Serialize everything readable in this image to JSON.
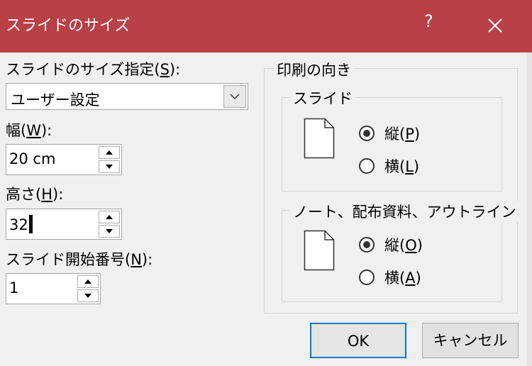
{
  "window": {
    "title": "スライドのサイズ",
    "help_label": "?"
  },
  "left": {
    "size_label_prefix": "スライドのサイズ指定(",
    "size_label_key": "S",
    "size_label_suffix": "):",
    "size_value": "ユーザー設定",
    "width_label_prefix": "幅(",
    "width_label_key": "W",
    "width_label_suffix": "):",
    "width_value": "20 cm",
    "height_label_prefix": "高さ(",
    "height_label_key": "H",
    "height_label_suffix": "):",
    "height_value": "32",
    "start_label_prefix": "スライド開始番号(",
    "start_label_key": "N",
    "start_label_suffix": "):",
    "start_value": "1"
  },
  "orientation": {
    "title": "印刷の向き",
    "slides": {
      "title": "スライド",
      "portrait_prefix": "縦(",
      "portrait_key": "P",
      "portrait_suffix": ")",
      "landscape_prefix": "横(",
      "landscape_key": "L",
      "landscape_suffix": ")",
      "selected": "portrait"
    },
    "notes": {
      "title": "ノート、配布資料、アウトライン",
      "portrait_prefix": "縦(",
      "portrait_key": "O",
      "portrait_suffix": ")",
      "landscape_prefix": "横(",
      "landscape_key": "A",
      "landscape_suffix": ")",
      "selected": "portrait"
    }
  },
  "buttons": {
    "ok": "OK",
    "cancel": "キャンセル"
  },
  "colors": {
    "titlebar": "#b94046",
    "ok_border": "#0078d7"
  }
}
